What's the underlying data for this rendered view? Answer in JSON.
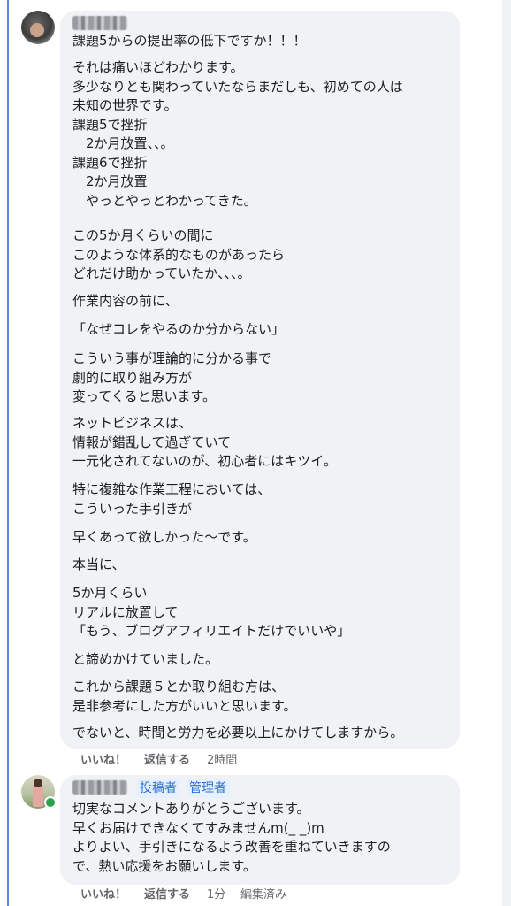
{
  "comments": [
    {
      "author": "",
      "paragraphs": [
        "課題5からの提出率の低下ですか！！！",
        "それは痛いほどわかります。\n多少なりとも関わっていたならまだしも、初めての人は\n未知の世界です。\n課題5で挫折\n　2か月放置、、。\n課題6で挫折\n　2か月放置\n　やっとやっとわかってきた。",
        "この5か月くらいの間に\nこのような体系的なものがあったら\nどれだけ助かっていたか、、、。",
        "作業内容の前に、",
        "「なぜコレをやるのか分からない」",
        "こういう事が理論的に分かる事で\n劇的に取り組み方が\n変ってくると思います。",
        "ネットビジネスは、\n情報が錯乱して過ぎていて\n一元化されてないのが、初心者にはキツイ。",
        "特に複雑な作業工程においては、\nこういった手引きが",
        "早くあって欲しかった～です。",
        "本当に、",
        "5か月くらい\nリアルに放置して\n「もう、ブログアフィリエイトだけでいいや」",
        "と諦めかけていました。",
        "これから課題５とか取り組む方は、\n是非参考にした方がいいと思います。",
        "でないと、時間と労力を必要以上にかけてしますから。"
      ],
      "like_label": "いいね！",
      "reply_label": "返信する",
      "time": "2時間",
      "edited": ""
    },
    {
      "author": "",
      "badges": [
        "投稿者",
        "管理者"
      ],
      "paragraphs": [
        "切実なコメントありがとうございます。\n早くお届けできなくてすみませんm(_ _)m\nよりよい、手引きになるよう改善を重ねていきますの\nで、熱い応援をお願いします。"
      ],
      "like_label": "いいね！",
      "reply_label": "返信する",
      "time": "1分",
      "edited": "編集済み"
    }
  ],
  "colors": {
    "bubble": "#f0f2f5",
    "badge_text": "#2d6fd8",
    "badge_bg": "#e7f0fd",
    "online": "#31a24c",
    "thread_line": "#5b8fd9"
  }
}
